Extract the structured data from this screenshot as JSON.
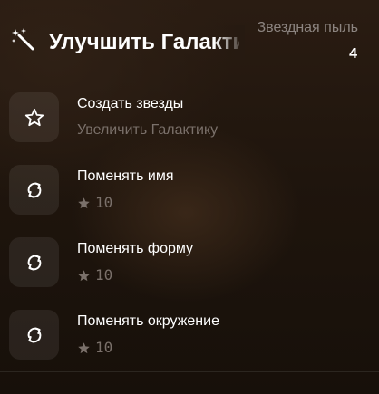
{
  "header": {
    "title": "Улучшить Галактику",
    "icon": "magic-wand-icon"
  },
  "stardust": {
    "label": "Звездная пыль",
    "value": "4"
  },
  "items": [
    {
      "title": "Создать звезды",
      "subtitle": "Увеличить Галактику",
      "icon": "star-outline-icon"
    },
    {
      "title": "Поменять имя",
      "cost": "10",
      "icon": "refresh-icon",
      "cost_icon": "star-icon"
    },
    {
      "title": "Поменять форму",
      "cost": "10",
      "icon": "refresh-icon",
      "cost_icon": "star-icon"
    },
    {
      "title": "Поменять окружение",
      "cost": "10",
      "icon": "refresh-icon",
      "cost_icon": "star-icon"
    }
  ],
  "colors": {
    "background": "#1f150d",
    "text_primary": "#ffffff",
    "text_secondary": "#7a706a",
    "icon_tile": "#342a23"
  }
}
